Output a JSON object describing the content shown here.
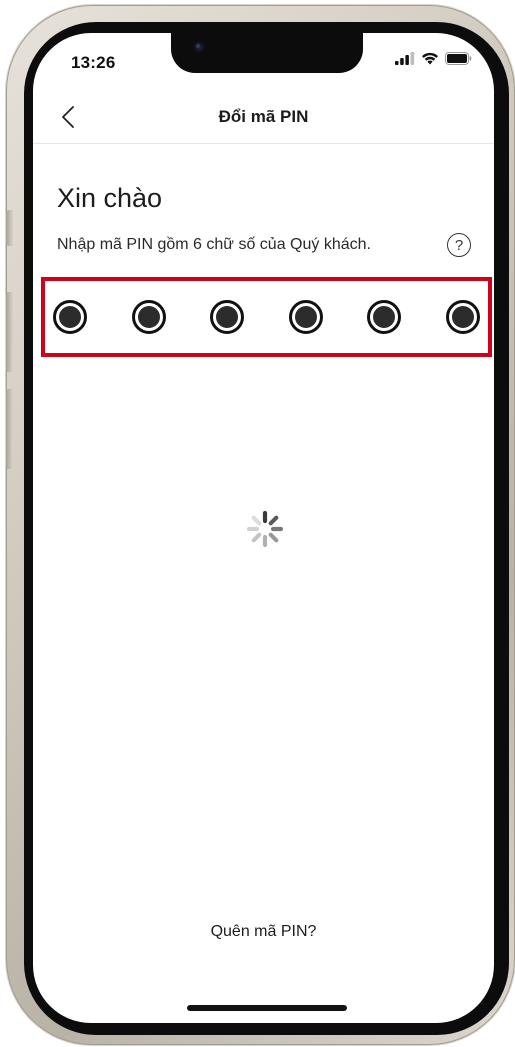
{
  "status_bar": {
    "time": "13:26",
    "icons": [
      "signal-icon",
      "wifi-icon",
      "battery-icon"
    ]
  },
  "nav": {
    "back_icon": "chevron-left-icon",
    "title": "Đổi mã PIN"
  },
  "main": {
    "greeting": "Xin chào",
    "instruction": "Nhập mã PIN gồm 6 chữ số của Quý khách.",
    "help_icon": "question-circle-icon",
    "help_glyph": "?",
    "pin_length": 6,
    "pin_filled": 6,
    "highlight_color": "#d0021b"
  },
  "loading": {
    "icon": "loading-spinner-icon"
  },
  "footer": {
    "forgot_pin_label": "Quên mã PIN?"
  }
}
